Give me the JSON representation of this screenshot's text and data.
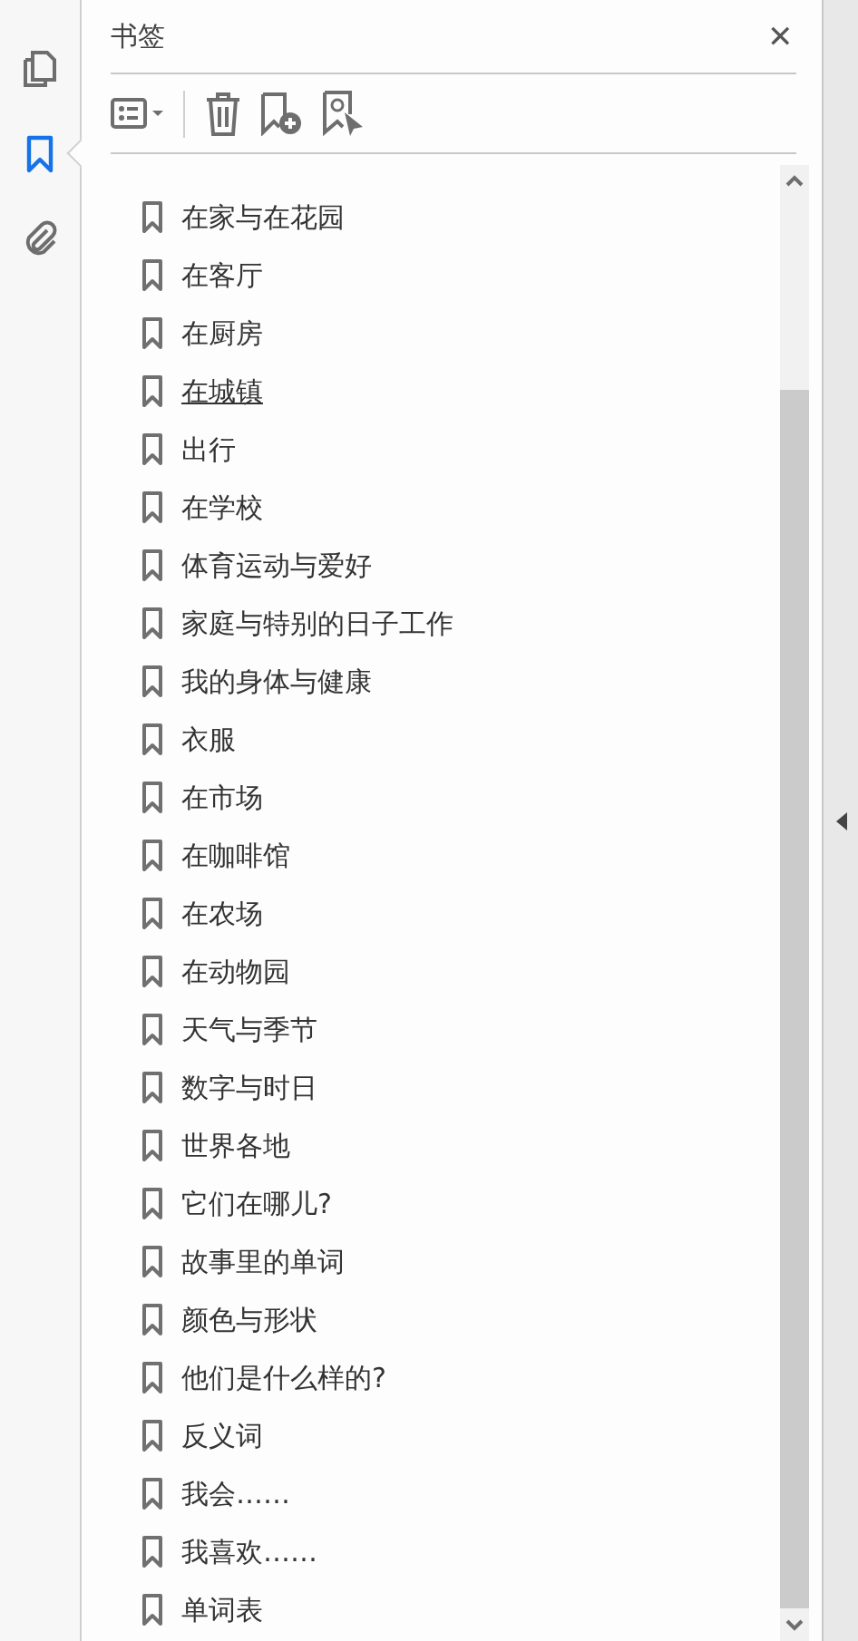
{
  "rail": [
    {
      "kind": "pages",
      "selected": false
    },
    {
      "kind": "bookmarks",
      "selected": true
    },
    {
      "kind": "attachments",
      "selected": false
    }
  ],
  "panel": {
    "title": "书签",
    "close": "✕"
  },
  "bookmarks": [
    {
      "label": "在家与在花园",
      "hovered": false
    },
    {
      "label": "在客厅",
      "hovered": false
    },
    {
      "label": "在厨房",
      "hovered": false
    },
    {
      "label": "在城镇",
      "hovered": true
    },
    {
      "label": "出行",
      "hovered": false
    },
    {
      "label": "在学校",
      "hovered": false
    },
    {
      "label": "体育运动与爱好",
      "hovered": false
    },
    {
      "label": "家庭与特别的日子工作",
      "hovered": false
    },
    {
      "label": "我的身体与健康",
      "hovered": false
    },
    {
      "label": "衣服",
      "hovered": false
    },
    {
      "label": "在市场",
      "hovered": false
    },
    {
      "label": "在咖啡馆",
      "hovered": false
    },
    {
      "label": "在农场",
      "hovered": false
    },
    {
      "label": "在动物园",
      "hovered": false
    },
    {
      "label": "天气与季节",
      "hovered": false
    },
    {
      "label": "数字与时日",
      "hovered": false
    },
    {
      "label": "世界各地",
      "hovered": false
    },
    {
      "label": "它们在哪儿?",
      "hovered": false
    },
    {
      "label": "故事里的单词",
      "hovered": false
    },
    {
      "label": "颜色与形状",
      "hovered": false
    },
    {
      "label": "他们是什么样的?",
      "hovered": false
    },
    {
      "label": "反义词",
      "hovered": false
    },
    {
      "label": "我会……",
      "hovered": false
    },
    {
      "label": "我喜欢……",
      "hovered": false
    },
    {
      "label": "单词表",
      "hovered": false
    }
  ]
}
